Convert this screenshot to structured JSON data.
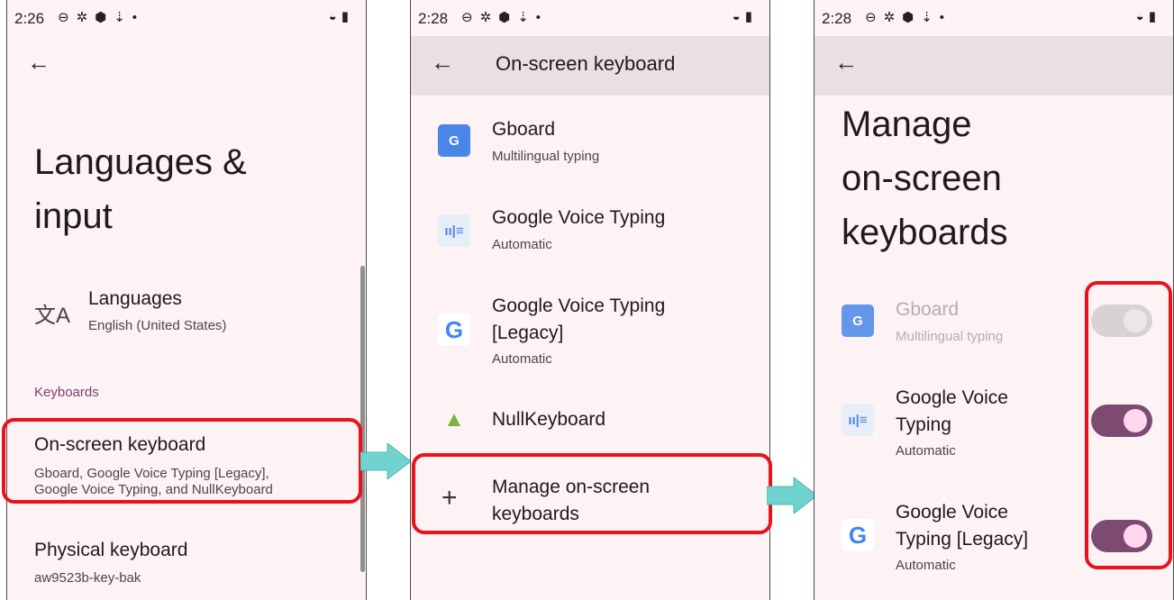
{
  "screens": [
    {
      "status": {
        "time": "2:26"
      },
      "title_line1": "Languages &",
      "title_line2": "input",
      "languages": {
        "title": "Languages",
        "subtitle": "English (United States)"
      },
      "section_keyboards": "Keyboards",
      "onscreen": {
        "title": "On-screen keyboard",
        "subtitle_line1": "Gboard, Google Voice Typing [Legacy],",
        "subtitle_line2": "Google Voice Typing, and NullKeyboard"
      },
      "physical": {
        "title": "Physical keyboard",
        "subtitle": "aw9523b-key-bak"
      }
    },
    {
      "status": {
        "time": "2:28"
      },
      "title": "On-screen keyboard",
      "items": [
        {
          "title": "Gboard",
          "subtitle": "Multilingual typing"
        },
        {
          "title": "Google Voice Typing",
          "subtitle": "Automatic"
        },
        {
          "title_line1": "Google Voice Typing",
          "title_line2": "[Legacy]",
          "subtitle": "Automatic"
        },
        {
          "title": "NullKeyboard"
        }
      ],
      "manage": {
        "line1": "Manage on-screen",
        "line2": "keyboards"
      }
    },
    {
      "status": {
        "time": "2:28"
      },
      "title_line1": "Manage",
      "title_line2": "on-screen",
      "title_line3": "keyboards",
      "items": [
        {
          "title": "Gboard",
          "subtitle": "Multilingual typing",
          "enabled": false,
          "checked": true
        },
        {
          "title_line1": "Google Voice",
          "title_line2": "Typing",
          "subtitle": "Automatic",
          "enabled": true,
          "checked": true
        },
        {
          "title_line1": "Google Voice",
          "title_line2": "Typing [Legacy]",
          "subtitle": "Automatic",
          "enabled": true,
          "checked": true
        }
      ]
    }
  ],
  "icons": {
    "status": [
      "sim-icon",
      "gear-icon",
      "shield-icon",
      "download-icon",
      "dot-icon",
      "wifi-icon",
      "battery-icon"
    ]
  },
  "colors": {
    "highlight": "#e8121a",
    "arrow": "#70d3d0",
    "toggle_on": "#7d4a72",
    "accent_text": "#7d3f6b"
  }
}
